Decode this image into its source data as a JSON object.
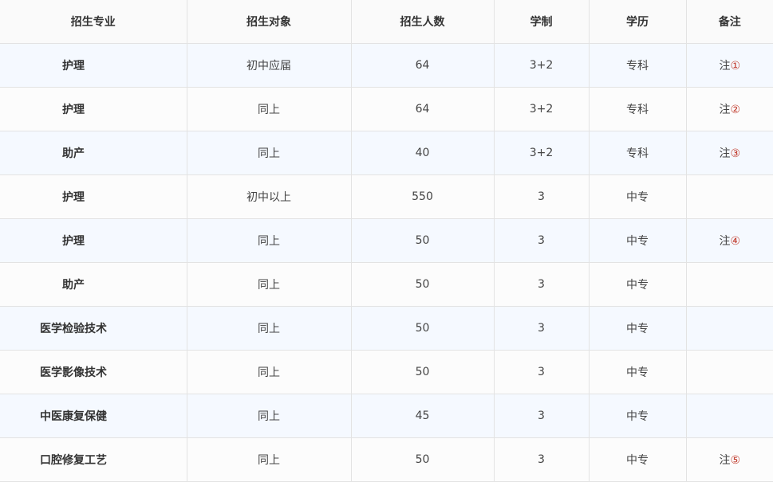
{
  "headers": [
    "招生专业",
    "招生对象",
    "招生人数",
    "学制",
    "学历",
    "备注"
  ],
  "rows": [
    {
      "major": "护理",
      "target": "初中应届",
      "count": "64",
      "years": "3+2",
      "degree": "专科",
      "note_prefix": "注",
      "note_mark": "①"
    },
    {
      "major": "护理",
      "target": "同上",
      "count": "64",
      "years": "3+2",
      "degree": "专科",
      "note_prefix": "注",
      "note_mark": "②"
    },
    {
      "major": "助产",
      "target": "同上",
      "count": "40",
      "years": "3+2",
      "degree": "专科",
      "note_prefix": "注",
      "note_mark": "③"
    },
    {
      "major": "护理",
      "target": "初中以上",
      "count": "550",
      "years": "3",
      "degree": "中专",
      "note_prefix": "",
      "note_mark": ""
    },
    {
      "major": "护理",
      "target": "同上",
      "count": "50",
      "years": "3",
      "degree": "中专",
      "note_prefix": "注",
      "note_mark": "④"
    },
    {
      "major": "助产",
      "target": "同上",
      "count": "50",
      "years": "3",
      "degree": "中专",
      "note_prefix": "",
      "note_mark": ""
    },
    {
      "major": "医学检验技术",
      "target": "同上",
      "count": "50",
      "years": "3",
      "degree": "中专",
      "note_prefix": "",
      "note_mark": ""
    },
    {
      "major": "医学影像技术",
      "target": "同上",
      "count": "50",
      "years": "3",
      "degree": "中专",
      "note_prefix": "",
      "note_mark": ""
    },
    {
      "major": "中医康复保健",
      "target": "同上",
      "count": "45",
      "years": "3",
      "degree": "中专",
      "note_prefix": "",
      "note_mark": ""
    },
    {
      "major": "口腔修复工艺",
      "target": "同上",
      "count": "50",
      "years": "3",
      "degree": "中专",
      "note_prefix": "注",
      "note_mark": "⑤"
    }
  ],
  "colors": {
    "note_mark": "#c0392b",
    "row_alt": "#f5f9ff",
    "header_bg": "#fafafa"
  }
}
